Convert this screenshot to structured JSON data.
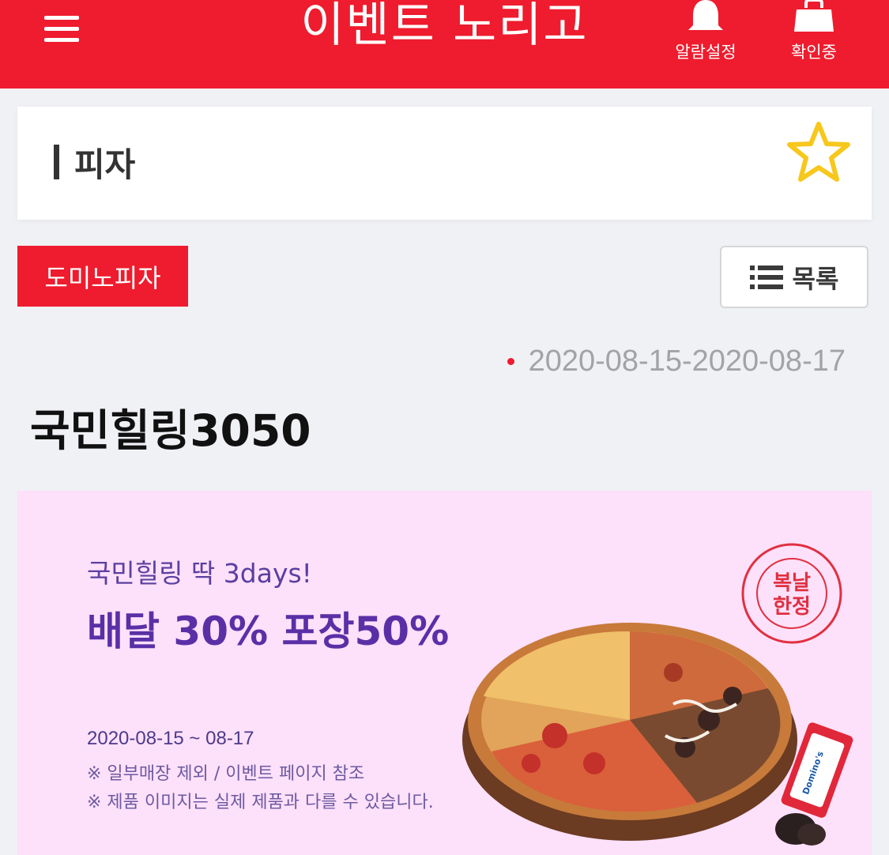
{
  "header": {
    "title": "이벤트 노리고",
    "alarm_label": "알람설정",
    "confirm_label": "확인중"
  },
  "category": {
    "title": "피자"
  },
  "brand": {
    "label": "도미노피자"
  },
  "list_button": {
    "label": "목록"
  },
  "event": {
    "date_range": "2020-08-15-2020-08-17",
    "title": "국민힐링3050"
  },
  "banner": {
    "subtitle": "국민힐링 딱 3days!",
    "headline": "배달 30% 포장50%",
    "period": "2020-08-15 ~ 08-17",
    "note1": "※ 일부매장 제외 / 이벤트 페이지 참조",
    "note2": "※ 제품 이미지는 실제 제품과 다를 수 있습니다.",
    "stamp_lines": [
      "복날",
      "한정"
    ],
    "stamp_ring": "summer limited edition",
    "sauce_brand": "Domino's"
  },
  "colors": {
    "brand_red": "#ee1c2e",
    "star_yellow": "#f7c71c",
    "banner_bg": "#fde0fa",
    "banner_text": "#5a2fa6"
  },
  "icons": [
    "menu-icon",
    "bell-icon",
    "shopping-bag-icon",
    "star-icon",
    "list-icon"
  ]
}
